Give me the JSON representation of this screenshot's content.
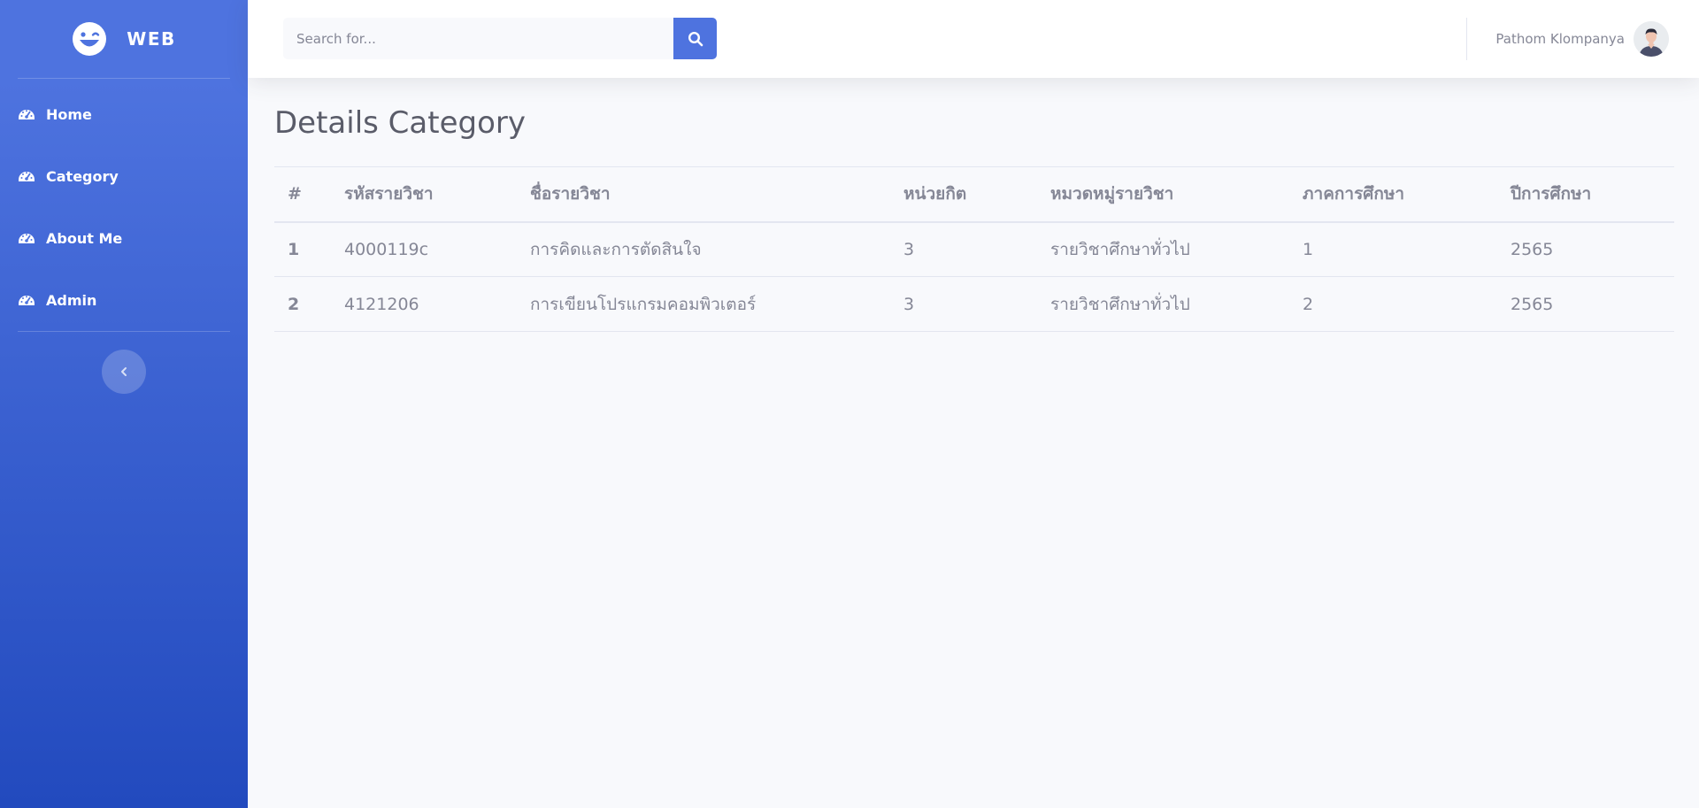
{
  "brand": {
    "name": "WEB",
    "icon": "laugh-wink-icon"
  },
  "sidebar": {
    "items": [
      {
        "label": "Home",
        "icon": "tachometer-icon"
      },
      {
        "label": "Category",
        "icon": "tachometer-icon"
      },
      {
        "label": "About Me",
        "icon": "tachometer-icon"
      },
      {
        "label": "Admin",
        "icon": "tachometer-icon"
      }
    ],
    "toggle_icon": "chevron-left-icon"
  },
  "topbar": {
    "search": {
      "placeholder": "Search for...",
      "value": "",
      "button_icon": "search-icon"
    },
    "user": {
      "name": "Pathom Klompanya",
      "avatar_icon": "user-avatar"
    }
  },
  "main": {
    "title": "Details Category",
    "table": {
      "headers": [
        "#",
        "รหัสรายวิชา",
        "ชื่อรายวิชา",
        "หน่วยกิต",
        "หมวดหมู่รายวิชา",
        "ภาคการศึกษา",
        "ปีการศึกษา"
      ],
      "rows": [
        [
          "1",
          "4000119c",
          "การคิดและการตัดสินใจ",
          "3",
          "รายวิชาศึกษาทั่วไป",
          "1",
          "2565"
        ],
        [
          "2",
          "4121206",
          "การเขียนโปรแกรมคอมพิวเตอร์",
          "3",
          "รายวิชาศึกษาทั่วไป",
          "2",
          "2565"
        ]
      ]
    }
  },
  "colors": {
    "primary": "#4e73df",
    "sidebar_gradient_end": "#224abe",
    "text_muted": "#858796",
    "title": "#5a5c69",
    "background": "#f8f9fc"
  }
}
